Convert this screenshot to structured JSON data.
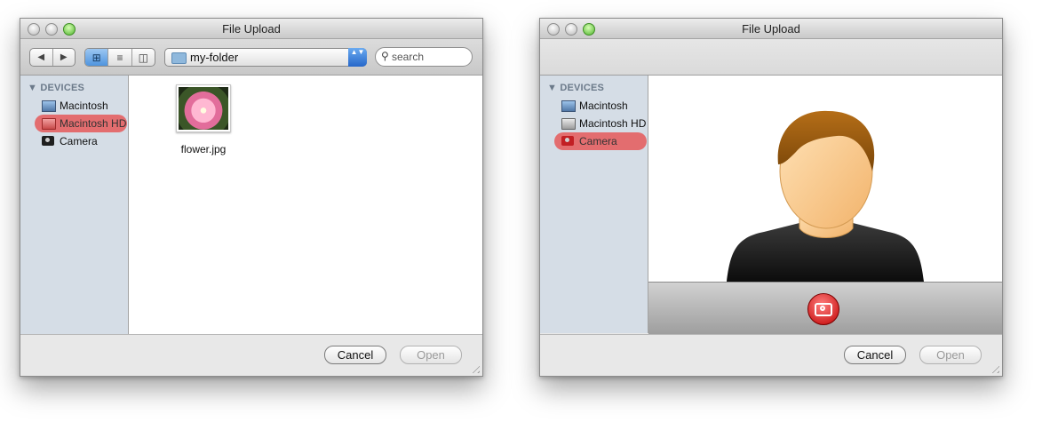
{
  "left_dialog": {
    "title": "File Upload",
    "toolbar": {
      "back": "◀",
      "forward": "▶",
      "views": [
        "⊞",
        "≡",
        "◫"
      ],
      "folder": "my-folder",
      "popup_arrows": "▲▼",
      "search_placeholder": "search"
    },
    "sidebar": {
      "group": "▼ DEVICES",
      "items": [
        {
          "label": "Macintosh",
          "icon": "computer-icon",
          "selected": false
        },
        {
          "label": "Macintosh HD",
          "icon": "hard-drive-icon",
          "selected": true
        },
        {
          "label": "Camera",
          "icon": "camera-icon",
          "selected": false
        }
      ]
    },
    "files": [
      {
        "name": "flower.jpg",
        "icon": "image-thumbnail"
      }
    ],
    "buttons": {
      "cancel": "Cancel",
      "open": "Open"
    }
  },
  "right_dialog": {
    "title": "File Upload",
    "sidebar": {
      "group": "▼ DEVICES",
      "items": [
        {
          "label": "Macintosh",
          "icon": "computer-icon",
          "selected": false
        },
        {
          "label": "Macintosh HD",
          "icon": "hard-drive-icon",
          "selected": false
        },
        {
          "label": "Camera",
          "icon": "camera-icon",
          "selected": true
        }
      ]
    },
    "camera_preview": "person-silhouette",
    "buttons": {
      "cancel": "Cancel",
      "open": "Open"
    }
  },
  "colors": {
    "selection": "#e36d6f",
    "sidebar_bg": "#d5dde6",
    "snap_button": "#d10000",
    "popup_accent": "#3b7fe0"
  }
}
